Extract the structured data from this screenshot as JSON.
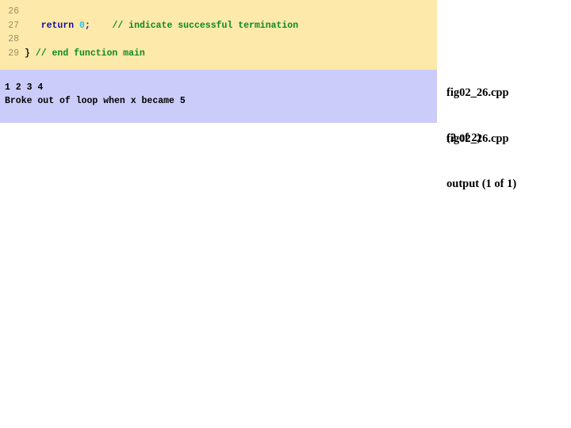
{
  "code_panel": {
    "name": "cpp-source-listing",
    "background": "#fde9a9",
    "lines": [
      {
        "number": "26",
        "segments": [
          {
            "kind": "plain",
            "text": ""
          }
        ]
      },
      {
        "number": "27",
        "segments": [
          {
            "kind": "plain",
            "text": "   "
          },
          {
            "kind": "keyword",
            "text": "return"
          },
          {
            "kind": "plain",
            "text": " "
          },
          {
            "kind": "number",
            "text": "0"
          },
          {
            "kind": "punct",
            "text": ";"
          },
          {
            "kind": "plain",
            "text": "    "
          },
          {
            "kind": "comment",
            "text": "// indicate successful termination"
          }
        ]
      },
      {
        "number": "28",
        "segments": [
          {
            "kind": "plain",
            "text": ""
          }
        ]
      },
      {
        "number": "29",
        "segments": [
          {
            "kind": "plain",
            "text": "} "
          },
          {
            "kind": "comment",
            "text": "// end function main"
          }
        ]
      }
    ]
  },
  "output_panel": {
    "name": "program-output",
    "background": "#ccccfa",
    "lines": [
      "1 2 3 4",
      "Broke out of loop when x became 5"
    ]
  },
  "captions": {
    "code": {
      "line1": "fig02_26.cpp",
      "line2": "(2 of 2)"
    },
    "output": {
      "line1": "fig02_26.cpp",
      "line2": "output (1 of 1)"
    }
  },
  "colors": {
    "code_background": "#fde9a9",
    "output_background": "#ccccfa",
    "line_number": "#9b9065",
    "keyword": "#11119e",
    "number_literal": "#2fc0e8",
    "comment": "#0a8a22",
    "plain_text": "#1a1a1a",
    "caption_text": "#000000",
    "page_background": "#ffffff"
  }
}
